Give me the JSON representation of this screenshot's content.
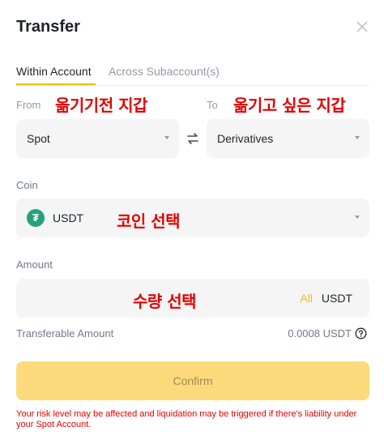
{
  "dialog": {
    "title": "Transfer"
  },
  "tabs": [
    {
      "label": "Within Account",
      "active": true
    },
    {
      "label": "Across Subaccount(s)",
      "active": false
    }
  ],
  "from": {
    "label": "From",
    "value": "Spot",
    "annotation": "옮기기전 지갑"
  },
  "to": {
    "label": "To",
    "value": "Derivatives",
    "annotation": "옮기고 싶은 지갑"
  },
  "coin": {
    "label": "Coin",
    "value": "USDT",
    "icon": "tether-icon",
    "icon_glyph": "₮",
    "icon_color": "#26a17b",
    "annotation": "코인 선택"
  },
  "amount": {
    "label": "Amount",
    "all_label": "All",
    "unit": "USDT",
    "annotation": "수량 선택"
  },
  "transferable": {
    "label": "Transferable Amount",
    "value": "0.0008 USDT"
  },
  "confirm": {
    "label": "Confirm"
  },
  "warning": {
    "text": "Your risk level may be affected and liquidation may be triggered if there's liability under your Spot Account."
  },
  "colors": {
    "accent": "#f0b90b",
    "confirm_bg": "#fcd97b",
    "annotation_red": "#e30000",
    "field_bg": "#f5f5f5"
  }
}
